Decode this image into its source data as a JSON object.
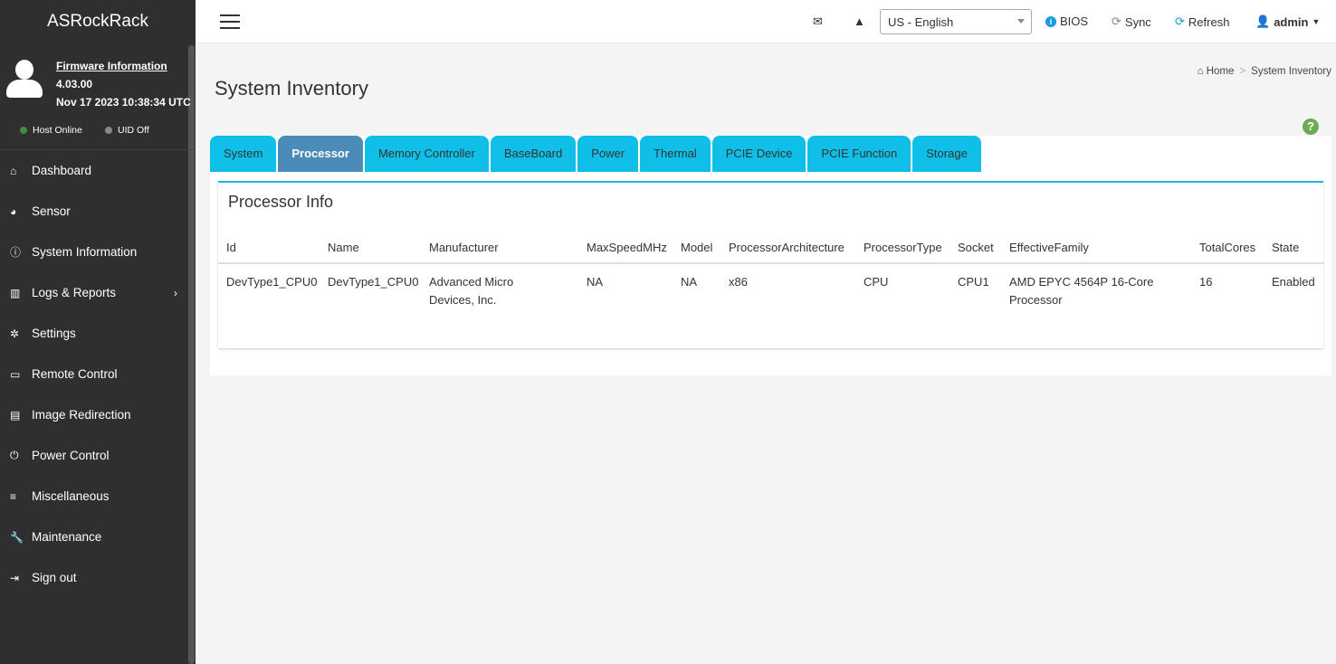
{
  "brand": "ASRockRack",
  "firmware": {
    "link": "Firmware Information",
    "version": "4.03.00",
    "date": "Nov 17 2023 10:38:34 UTC"
  },
  "status": {
    "host": "Host Online",
    "uid": "UID Off",
    "colors": {
      "host": "#3d8f3d",
      "uid": "#888888"
    }
  },
  "nav": [
    {
      "label": "Dashboard",
      "icon": "home-icon"
    },
    {
      "label": "Sensor",
      "icon": "gauge-icon"
    },
    {
      "label": "System Information",
      "icon": "info-icon"
    },
    {
      "label": "Logs & Reports",
      "icon": "chart-icon"
    },
    {
      "label": "Settings",
      "icon": "gear-icon"
    },
    {
      "label": "Remote Control",
      "icon": "monitor-icon"
    },
    {
      "label": "Image Redirection",
      "icon": "drive-icon"
    },
    {
      "label": "Power Control",
      "icon": "power-icon"
    },
    {
      "label": "Miscellaneous",
      "icon": "list-icon"
    },
    {
      "label": "Maintenance",
      "icon": "wrench-icon"
    },
    {
      "label": "Sign out",
      "icon": "signout-icon"
    }
  ],
  "header": {
    "language": "US - English",
    "bios": "BIOS",
    "sync": "Sync",
    "refresh": "Refresh",
    "user": "admin"
  },
  "page": {
    "title": "System Inventory",
    "breadcrumb": [
      "Home",
      "System Inventory"
    ]
  },
  "tabs": [
    "System",
    "Processor",
    "Memory Controller",
    "BaseBoard",
    "Power",
    "Thermal",
    "PCIE Device",
    "PCIE Function",
    "Storage"
  ],
  "active_tab": "Processor",
  "section": "Processor Info",
  "table": {
    "columns": [
      "Id",
      "Name",
      "Manufacturer",
      "MaxSpeedMHz",
      "Model",
      "ProcessorArchitecture",
      "ProcessorType",
      "Socket",
      "EffectiveFamily",
      "TotalCores",
      "State"
    ],
    "rows": [
      [
        "DevType1_CPU0",
        "DevType1_CPU0",
        "Advanced Micro Devices, Inc.",
        "NA",
        "NA",
        "x86",
        "CPU",
        "CPU1",
        "AMD EPYC 4564P 16-Core Processor",
        "16",
        "Enabled"
      ]
    ]
  }
}
